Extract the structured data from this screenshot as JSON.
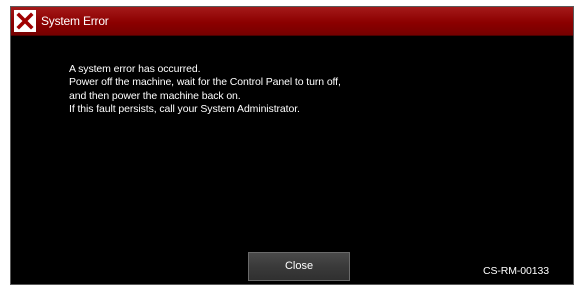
{
  "dialog": {
    "title": "System Error",
    "title_icon": "close-x-icon",
    "message_lines": [
      "A system error has occurred.",
      "Power off the machine, wait for the Control Panel to turn off,",
      "and then power the machine back on.",
      "If this fault persists, call your System Administrator."
    ],
    "close_label": "Close",
    "error_code": "CS-RM-00133"
  },
  "colors": {
    "title_bar": "#8c0000",
    "background": "#000000",
    "text": "#ffffff",
    "button": "#3a3a3a"
  }
}
